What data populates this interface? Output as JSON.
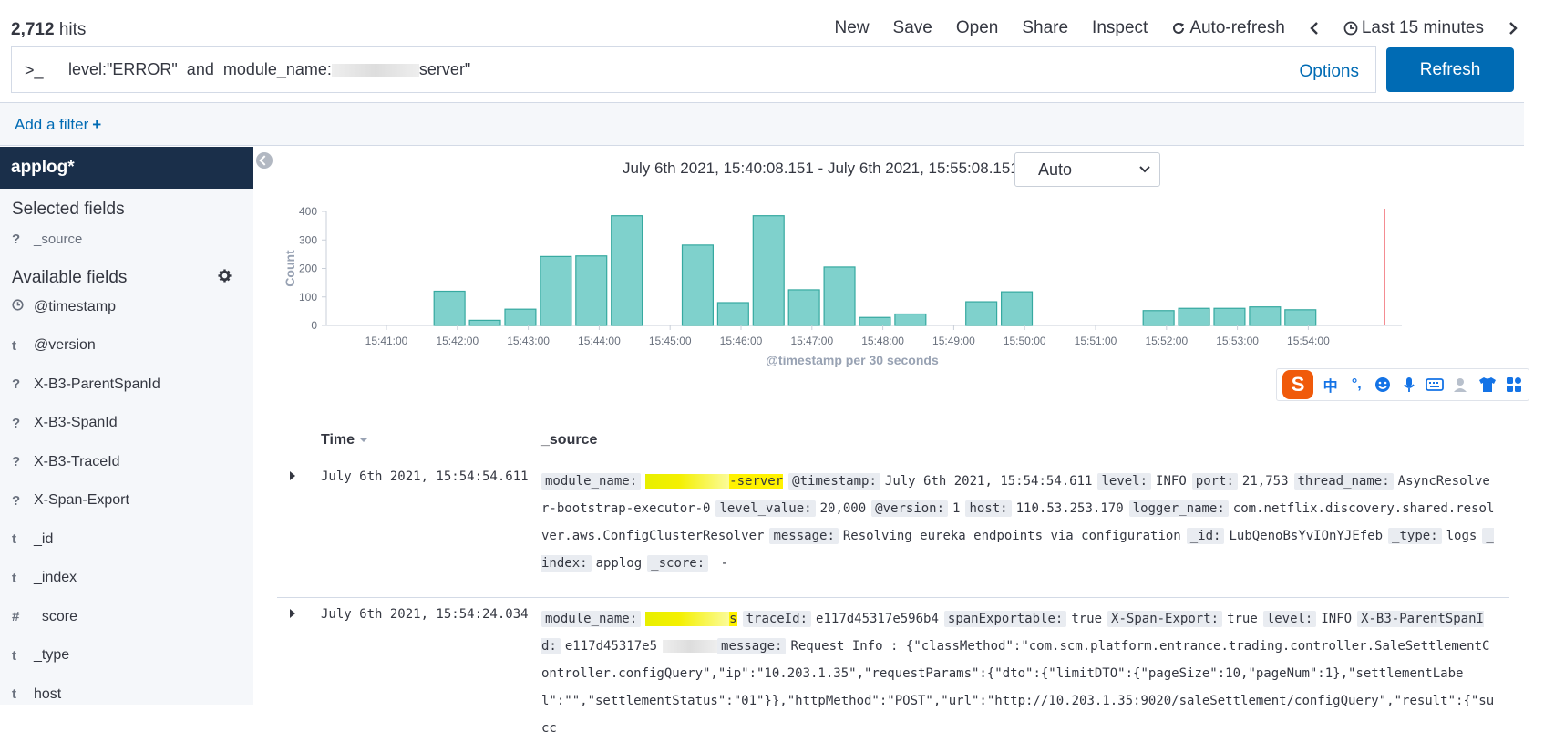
{
  "topbar": {
    "hits_count": "2,712",
    "hits_label": "hits",
    "menu": {
      "new": "New",
      "save": "Save",
      "open": "Open",
      "share": "Share",
      "inspect": "Inspect",
      "auto_refresh": "Auto-refresh",
      "time_range": "Last 15 minutes"
    }
  },
  "query": {
    "prompt": ">_",
    "text_prefix": "level:\"ERROR\"  and  module_name:",
    "text_suffix": "server\"",
    "options_label": "Options",
    "refresh_label": "Refresh"
  },
  "filter": {
    "add_filter_label": "Add a filter",
    "plus": "+"
  },
  "sidebar": {
    "index_pattern": "applog*",
    "selected_title": "Selected fields",
    "selected_fields": [
      {
        "type": "?",
        "name": "_source"
      }
    ],
    "available_title": "Available fields",
    "available_fields": [
      {
        "type": "clock",
        "name": "@timestamp"
      },
      {
        "type": "t",
        "name": "@version"
      },
      {
        "type": "?",
        "name": "X-B3-ParentSpanId"
      },
      {
        "type": "?",
        "name": "X-B3-SpanId"
      },
      {
        "type": "?",
        "name": "X-B3-TraceId"
      },
      {
        "type": "?",
        "name": "X-Span-Export"
      },
      {
        "type": "t",
        "name": "_id"
      },
      {
        "type": "t",
        "name": "_index"
      },
      {
        "type": "#",
        "name": "_score"
      },
      {
        "type": "t",
        "name": "_type"
      },
      {
        "type": "t",
        "name": "host"
      }
    ]
  },
  "main": {
    "time_range_text": "July 6th 2021, 15:40:08.151 - July 6th 2021, 15:55:08.151 —",
    "interval_selected": "Auto"
  },
  "chart_data": {
    "type": "bar",
    "title": "",
    "xlabel": "@timestamp per 30 seconds",
    "ylabel": "Count",
    "ylim": [
      0,
      400
    ],
    "yticks": [
      0,
      100,
      200,
      300,
      400
    ],
    "xticks": [
      "15:41:00",
      "15:42:00",
      "15:43:00",
      "15:44:00",
      "15:45:00",
      "15:46:00",
      "15:47:00",
      "15:48:00",
      "15:49:00",
      "15:50:00",
      "15:51:00",
      "15:52:00",
      "15:53:00",
      "15:54:00"
    ],
    "bar_color": "#7fd1cc",
    "bar_stroke": "#36a9a0",
    "categories": [
      "15:40:30",
      "15:41:00",
      "15:41:30",
      "15:42:00",
      "15:42:30",
      "15:43:00",
      "15:43:30",
      "15:44:00",
      "15:44:30",
      "15:45:00",
      "15:45:30",
      "15:46:00",
      "15:46:30",
      "15:47:00",
      "15:47:30",
      "15:48:00",
      "15:48:30",
      "15:49:00",
      "15:49:30",
      "15:50:00",
      "15:50:30",
      "15:51:00",
      "15:51:30",
      "15:52:00",
      "15:52:30",
      "15:53:00",
      "15:53:30",
      "15:54:00",
      "15:54:30"
    ],
    "values": [
      0,
      0,
      0,
      120,
      18,
      57,
      242,
      244,
      385,
      0,
      282,
      80,
      385,
      125,
      205,
      28,
      40,
      0,
      83,
      118,
      0,
      0,
      0,
      52,
      60,
      60,
      65,
      55,
      0
    ],
    "now_marker_color": "#f0666e",
    "grid": false
  },
  "table": {
    "col_time": "Time",
    "col_source": "_source",
    "rows": [
      {
        "time": "July 6th 2021, 15:54:54.611",
        "fields": [
          {
            "k": "module_name:",
            "v": "-server",
            "hl": true,
            "redacted": true
          },
          {
            "k": "@timestamp:",
            "v": "July 6th 2021, 15:54:54.611"
          },
          {
            "k": "level:",
            "v": "INFO"
          },
          {
            "k": "port:",
            "v": "21,753"
          },
          {
            "k": "thread_name:",
            "v": "AsyncResolver-bootstrap-executor-0"
          },
          {
            "k": "level_value:",
            "v": "20,000"
          },
          {
            "k": "@version:",
            "v": "1"
          },
          {
            "k": "host:",
            "v": "110.53.253.170"
          },
          {
            "k": "logger_name:",
            "v": "com.netflix.discovery.shared.resolver.aws.ConfigClusterResolver"
          },
          {
            "k": "message:",
            "v": "Resolving eureka endpoints via configuration"
          },
          {
            "k": "_id:",
            "v": "LubQenoBsYvIOnYJEfeb"
          },
          {
            "k": "_type:",
            "v": "logs"
          },
          {
            "k": "_index:",
            "v": "applog"
          },
          {
            "k": "_score:",
            "v": " -"
          }
        ]
      },
      {
        "time": "July 6th 2021, 15:54:24.034",
        "fields": [
          {
            "k": "module_name:",
            "v": "s",
            "hl": true,
            "redacted": true
          },
          {
            "k": "traceId:",
            "v": "e117d45317e596b4",
            "k_partial": "raceId:"
          },
          {
            "k": "spanExportable:",
            "v": "true"
          },
          {
            "k": "X-Span-Export:",
            "v": "true"
          },
          {
            "k": "level:",
            "v": "INFO"
          },
          {
            "k": "X-B3-ParentSpanId:",
            "v": "e117d45317e5",
            "redacted_tail": true
          },
          {
            "k": "message:",
            "v": "Request Info : {\"classMethod\":\"com.scm.platform.entrance.trading.controller.SaleSettlementController.configQuery\",\"ip\":\"10.203.1.35\",\"requestParams\":{\"dto\":{\"limitDTO\":{\"pageSize\":10,\"pageNum\":1},\"settlementLabel\":\"\",\"settlementStatus\":\"01\"}},\"httpMethod\":\"POST\",\"url\":\"http://10.203.1.35:9020/saleSettlement/configQuery\",\"result\":{\"succ"
          }
        ]
      }
    ]
  },
  "ime": {
    "logo": "S",
    "lang": "中",
    "punct": "°,"
  }
}
